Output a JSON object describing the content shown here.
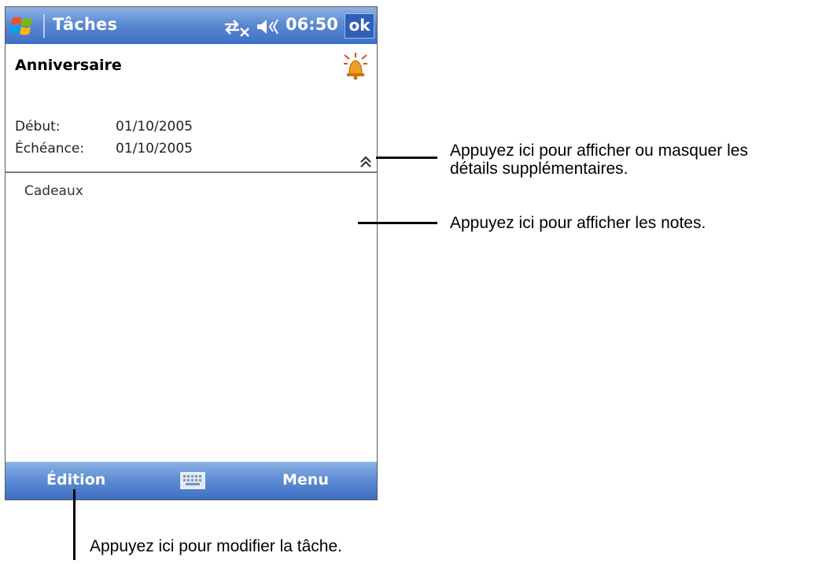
{
  "titlebar": {
    "app_title": "Tâches",
    "clock": "06:50",
    "ok_label": "ok",
    "icons": [
      "windows-start-icon",
      "connectivity-icon",
      "volume-icon"
    ]
  },
  "task": {
    "subject": "Anniversaire",
    "start_label": "Début:",
    "start_value": "01/10/2005",
    "due_label": "Échéance:",
    "due_value": "01/10/2005",
    "notes": "Cadeaux"
  },
  "menubar": {
    "left_label": "Édition",
    "right_label": "Menu"
  },
  "callouts": {
    "toggle_line1": "Appuyez ici pour afficher ou masquer les",
    "toggle_line2": "détails supplémentaires.",
    "notes": "Appuyez ici pour afficher les notes.",
    "edit": "Appuyez ici pour modifier la tâche."
  },
  "colors": {
    "bar_blue": "#3e6fc4",
    "bar_light": "#8fb3e6",
    "ok_bg": "#2f5fb8"
  }
}
